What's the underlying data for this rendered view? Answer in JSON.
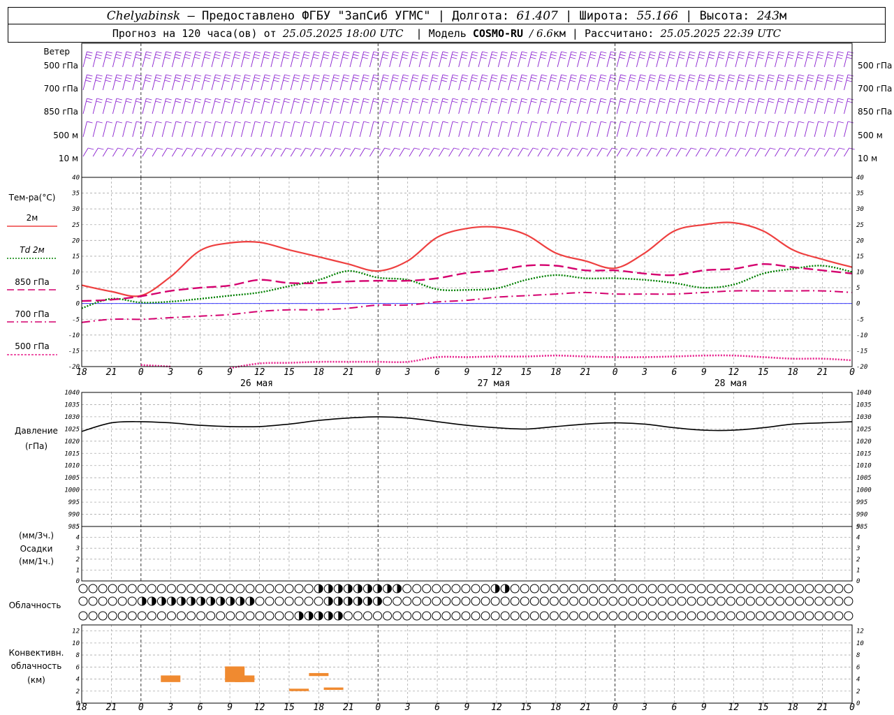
{
  "header": {
    "city": "Chelyabinsk",
    "provider": "— Предоставлено ФГБУ \"ЗапСиб УГМС\"",
    "lon_label": "Долгота:",
    "lon": "61.407",
    "lat_label": "Широта:",
    "lat": "55.166",
    "alt_label": "Высота:",
    "alt": "243",
    "alt_unit": "м",
    "forecast_label": "Прогноз на 120 часа(ов) от",
    "forecast_time": "25.05.2025 18:00 UTC",
    "model_label": "Модель",
    "model_name": "COSMO-RU",
    "model_res": "/ 6.6",
    "model_res_unit": "км",
    "calc_label": "Рассчитано:",
    "calc_time": "25.05.2025 22:39 UTC"
  },
  "panels": {
    "wind": {
      "title": "Ветер",
      "levels": [
        "500 гПа",
        "700 гПа",
        "850 гПа",
        "500 м",
        "10  м"
      ]
    },
    "temp": {
      "title": "Тем-ра(°С)",
      "legend": [
        "2м",
        "Td  2м",
        "850 гПа",
        "700 гПа",
        "500 гПа"
      ]
    },
    "pressure": {
      "title": "Давление",
      "unit": "(гПа)"
    },
    "precip": {
      "title": "Осадки",
      "unit_top": "(мм/3ч.)",
      "unit_bottom": "(мм/1ч.)"
    },
    "cloud": {
      "title": "Облачность"
    },
    "conv": {
      "title_1": "Конвективн.",
      "title_2": "облачность",
      "unit": "(км)"
    }
  },
  "colors": {
    "t2m": "#ee4040",
    "td2m": "#008000",
    "t850": "#d4006e",
    "t700": "#d4006e",
    "t500": "#e8208c",
    "wind": "#8a20d0",
    "pressure": "#000000",
    "conv": "#f08a30",
    "zero_line": "#2020ff"
  },
  "chart_data": [
    {
      "type": "line",
      "title": "Тем-ра(°С)",
      "x_hours": [
        -6,
        -3,
        0,
        3,
        6,
        9,
        12,
        15,
        18,
        21,
        24,
        27,
        30,
        33,
        36,
        39,
        42,
        45,
        48,
        51,
        54,
        57,
        60,
        63,
        66,
        69,
        72
      ],
      "x_tick_labels": [
        "18",
        "21",
        "0",
        "3",
        "6",
        "9",
        "12",
        "15",
        "18",
        "21",
        "0",
        "3",
        "6",
        "9",
        "12",
        "15",
        "18",
        "21",
        "0",
        "3",
        "6",
        "9",
        "12",
        "15",
        "18",
        "21",
        "0"
      ],
      "day_labels": [
        "26 мая",
        "27 мая",
        "28 мая"
      ],
      "ylim": [
        -20,
        40
      ],
      "y_ticks": [
        -20,
        -15,
        -10,
        -5,
        0,
        5,
        10,
        15,
        20,
        25,
        30,
        35,
        40
      ],
      "series": [
        {
          "name": "2м",
          "style": "solid",
          "values": [
            5.8,
            3.8,
            2.5,
            8.5,
            16.8,
            19.2,
            19.4,
            17.0,
            14.8,
            12.5,
            10.3,
            13.5,
            21.0,
            23.8,
            24.2,
            21.8,
            16.0,
            13.5,
            11.2,
            16.0,
            23.0,
            25.0,
            25.6,
            23.0,
            17.0,
            14.0,
            11.5
          ]
        },
        {
          "name": "Td  2м",
          "style": "dotted",
          "values": [
            -1.5,
            1.5,
            0.3,
            0.6,
            1.5,
            2.5,
            3.5,
            5.5,
            7.5,
            10.3,
            8.2,
            7.5,
            4.5,
            4.3,
            4.8,
            7.5,
            9.0,
            8.0,
            8.0,
            7.5,
            6.5,
            5.0,
            6.0,
            9.5,
            11.0,
            12.0,
            10.0
          ]
        },
        {
          "name": "850 гПа",
          "style": "dash",
          "values": [
            0.8,
            1.2,
            2.3,
            4.0,
            5.0,
            5.7,
            7.5,
            6.5,
            6.5,
            7.0,
            7.2,
            7.2,
            8.0,
            9.7,
            10.5,
            12.0,
            12.0,
            10.5,
            10.5,
            9.5,
            9.0,
            10.5,
            11.0,
            12.5,
            11.5,
            10.5,
            9.5
          ]
        },
        {
          "name": "700 гПа",
          "style": "dashdot",
          "values": [
            -6.0,
            -5.0,
            -5.0,
            -4.5,
            -4.0,
            -3.5,
            -2.5,
            -2.0,
            -2.0,
            -1.5,
            -0.5,
            -0.5,
            0.5,
            1.0,
            2.0,
            2.5,
            3.0,
            3.5,
            3.0,
            3.0,
            3.0,
            3.5,
            4.0,
            4.0,
            4.0,
            4.0,
            3.5
          ]
        },
        {
          "name": "500 гПа",
          "style": "dotted",
          "values": [
            null,
            null,
            -19.5,
            -20.0,
            null,
            -20.5,
            -19.0,
            -18.8,
            -18.5,
            -18.5,
            -18.5,
            -18.5,
            -17.0,
            -17.0,
            -16.8,
            -16.8,
            -16.5,
            -16.8,
            -17.0,
            -17.0,
            -16.8,
            -16.5,
            -16.5,
            -17.0,
            -17.5,
            -17.5,
            -18.0
          ]
        }
      ]
    },
    {
      "type": "line",
      "title": "Давление",
      "ylim": [
        985,
        1040
      ],
      "y_ticks": [
        985,
        990,
        995,
        1000,
        1005,
        1010,
        1015,
        1020,
        1025,
        1030,
        1035,
        1040
      ],
      "x_hours": [
        -6,
        -3,
        0,
        3,
        6,
        9,
        12,
        15,
        18,
        21,
        24,
        27,
        30,
        33,
        36,
        39,
        42,
        45,
        48,
        51,
        54,
        57,
        60,
        63,
        66,
        69,
        72
      ],
      "series": [
        {
          "name": "",
          "style": "solid",
          "values": [
            1024,
            1027.5,
            1028,
            1027.5,
            1026.5,
            1026,
            1026,
            1027,
            1028.5,
            1029.5,
            1030,
            1029.5,
            1028,
            1026.5,
            1025.5,
            1025,
            1026,
            1027,
            1027.5,
            1027,
            1025.5,
            1024.5,
            1024.5,
            1025.5,
            1027,
            1027.5,
            1028
          ]
        }
      ]
    },
    {
      "type": "bar",
      "title": "Осадки",
      "ylim": [
        0,
        5
      ],
      "y_ticks": [
        0,
        1,
        2,
        3,
        4,
        5
      ],
      "series": [
        {
          "name": "",
          "values": []
        }
      ]
    },
    {
      "type": "bar",
      "title": "Конвективн. облачность",
      "ylim": [
        0,
        13
      ],
      "y_ticks": [
        0,
        2,
        4,
        6,
        8,
        10,
        12
      ],
      "series": [
        {
          "name": "",
          "bars_km": [
            {
              "h": 3,
              "from": 3.5,
              "to": 4.6
            },
            {
              "h": 9.5,
              "from": 3.5,
              "to": 6.1
            },
            {
              "h": 10.5,
              "from": 3.5,
              "to": 4.6
            },
            {
              "h": 16,
              "from": 2.0,
              "to": 2.4
            },
            {
              "h": 18,
              "from": 4.5,
              "to": 5.0
            },
            {
              "h": 19.5,
              "from": 2.2,
              "to": 2.6
            }
          ]
        }
      ]
    }
  ]
}
